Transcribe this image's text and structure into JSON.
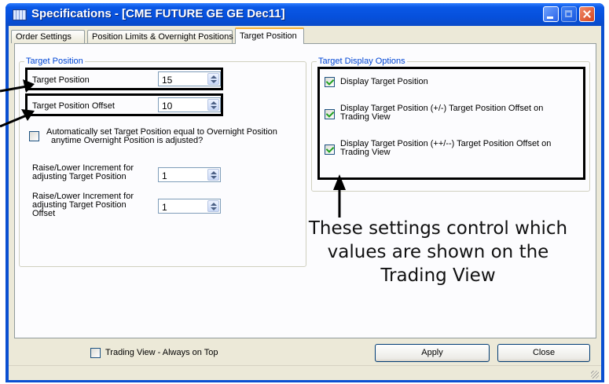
{
  "window": {
    "title": "Specifications - [CME FUTURE GE GE Dec11]"
  },
  "tabs": [
    {
      "label": "Order Settings",
      "active": false
    },
    {
      "label": "Position Limits & Overnight Positions",
      "active": false
    },
    {
      "label": "Target Position",
      "active": true
    }
  ],
  "target_position_group": {
    "title": "Target Position",
    "target_position": {
      "label": "Target Position",
      "value": "15"
    },
    "target_position_offset": {
      "label": "Target Position Offset",
      "value": "10"
    },
    "auto_set": {
      "line1": "Automatically set Target Position equal to Overnight Position",
      "line2": "anytime Overnight Position is adjusted?",
      "checked": false
    },
    "raise_lower_target": {
      "line1": "Raise/Lower Increment for",
      "line2": "adjusting Target Position",
      "value": "1"
    },
    "raise_lower_offset": {
      "line1": "Raise/Lower Increment for",
      "line2": "adjusting Target Position",
      "line3": "Offset",
      "value": "1"
    }
  },
  "display_group": {
    "title": "Target Display Options",
    "options": [
      {
        "line1": "Display Target Position",
        "line2": "",
        "checked": true
      },
      {
        "line1": "Display Target Position (+/-) Target Position Offset on",
        "line2": "Trading View",
        "checked": true
      },
      {
        "line1": "Display Target Position (++/--) Target Position Offset on",
        "line2": "Trading View",
        "checked": true
      }
    ]
  },
  "annotation": {
    "line1": "These settings control which",
    "line2": "values are shown on the",
    "line3": "Trading View"
  },
  "footer": {
    "always_on_top": {
      "label": "Trading View - Always on Top",
      "checked": false
    },
    "apply_label": "Apply",
    "close_label": "Close"
  },
  "colors": {
    "title_bar": "#0a58e6",
    "group_title": "#0046d5",
    "dialog_bg": "#ece9d8",
    "highlight_box": "#000000"
  },
  "icons": [
    "app-window-icon",
    "minimize-icon",
    "maximize-icon",
    "close-icon",
    "annotation-arrow-icon",
    "resize-grip-icon"
  ]
}
